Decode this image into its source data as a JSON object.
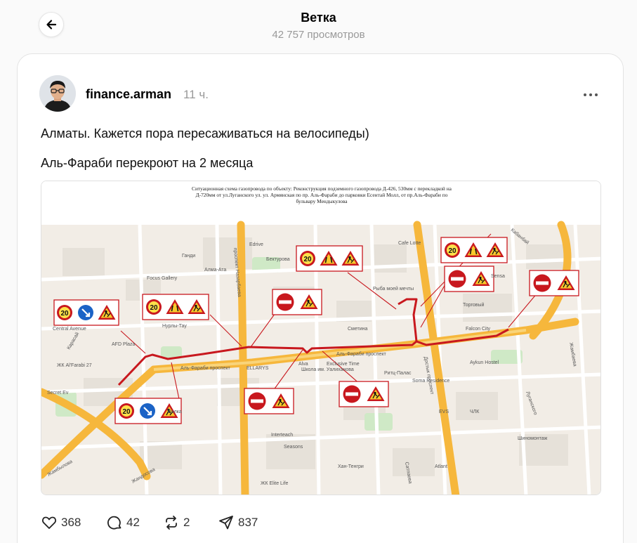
{
  "header": {
    "title": "Ветка",
    "views": "42 757 просмотров"
  },
  "post": {
    "username": "finance.arman",
    "time": "11 ч.",
    "text_line1": "Алматы. Кажется пора пересаживаться на велосипеды)",
    "text_line2": "Аль-Фараби перекроют на 2 месяца"
  },
  "map": {
    "caption_line1": "Ситуационная схема газопровода по объекту: Реконструкция подземного газопровода Д-426, 530мм с перекладкой на",
    "caption_line2": "Д-720мм от ул.Луганского ул. ул. Армянская по пр. Аль-Фараби до парковки Есентай Молл, от пр.Аль-Фараби по",
    "caption_line3": "бульвару Мендыкулова",
    "speed_sign": "20",
    "labels": {
      "bektorova": "Бектурова",
      "satpaeva": "Сметина",
      "alfarabi1": "Аль-Фараби проспект",
      "alfarabi2": "Аль-Фараби проспект",
      "cafe": "Cafe Lotte",
      "ryba": "Рыба моей мечты",
      "falcon": "Falcon City",
      "aykun": "Aykun Hostel",
      "central": "Central Avenue",
      "alfarabi27": "ЖК Al'Farabi 27",
      "secret": "Secret Ev",
      "almaata": "Алма-Ата",
      "focus": "Focus Gallery",
      "nurly": "Нурлы-Тау",
      "afd": "AFD Plaza",
      "ritz": "Ритц-Палас",
      "soma": "Soma Residence",
      "evs": "EVS",
      "interteach": "Interteach",
      "khan": "Хан-Тенгри",
      "atlant": "Atlant",
      "shinomontazh": "Шиномонтаж",
      "lugansk": "Луганского",
      "zhambyl": "Жамбылова",
      "nazarbaev": "проспект Назарбаева",
      "dostyk": "Достык проспект",
      "baizakov": "Сатпаева",
      "kabanbay": "Кабанбай",
      "bul": "Жамбаева",
      "vilka": "Вилка",
      "sepa": "Seasons",
      "edrive": "Edrive",
      "karasay": "Карасай",
      "torgovy": "Торговый",
      "zhk": "ЖК Elite Life",
      "school": "Школа им. Уалиханова",
      "exclusive": "Exclusive Time",
      "alva": "Alva",
      "ellary": "ELLARYS",
      "chlk": "ЧЛК",
      "snabzh": "Sensa",
      "gandi": "Ганди",
      "zhanshak": "Жандосова"
    }
  },
  "actions": {
    "likes": "368",
    "comments": "42",
    "reposts": "2",
    "shares": "837"
  },
  "colors": {
    "card_bg": "#ffffff",
    "page_bg": "#fafafa",
    "closure_red": "#c8181e",
    "road_yellow": "#f6b73c"
  }
}
